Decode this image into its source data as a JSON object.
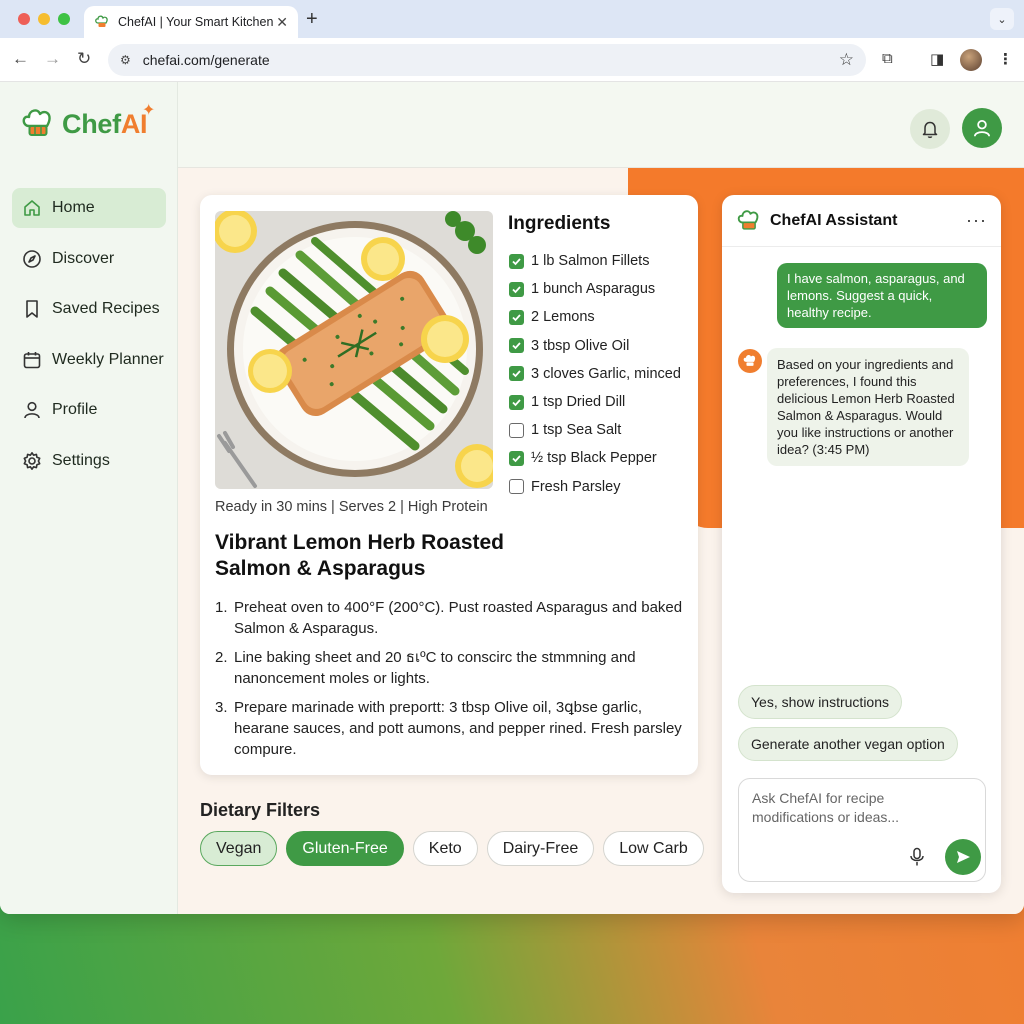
{
  "browser": {
    "tab_title": "ChefAI | Your Smart Kitchen",
    "url": "chefai.com/generate",
    "traffic_lights": [
      "#ee5f57",
      "#f6bd2f",
      "#3ec244"
    ]
  },
  "brand": {
    "name_prefix": "Chef",
    "name_suffix": "AI",
    "green": "#3f9a45",
    "orange": "#f07e2f"
  },
  "sidebar": {
    "items": [
      {
        "label": "Home",
        "icon": "home-icon",
        "active": true
      },
      {
        "label": "Discover",
        "icon": "compass-icon",
        "active": false
      },
      {
        "label": "Saved Recipes",
        "icon": "bookmark-icon",
        "active": false
      },
      {
        "label": "Weekly Planner",
        "icon": "calendar-icon",
        "active": false
      },
      {
        "label": "Profile",
        "icon": "person-icon",
        "active": false
      },
      {
        "label": "Settings",
        "icon": "gear-icon",
        "active": false
      }
    ]
  },
  "header": {
    "notifications_icon": "bell-icon",
    "user_icon": "user-icon"
  },
  "recipe": {
    "meta": "Ready in 30 mins | Serves 2 | High Protein",
    "title": "Vibrant Lemon Herb Roasted Salmon & Asparagus",
    "ingredients_title": "Ingredients",
    "ingredients": [
      {
        "label": "1 lb Salmon Fillets",
        "checked": true
      },
      {
        "label": "1 bunch Asparagus",
        "checked": true
      },
      {
        "label": "2 Lemons",
        "checked": true
      },
      {
        "label": "3 tbsp Olive Oil",
        "checked": true
      },
      {
        "label": "3 cloves Garlic, minced",
        "checked": true
      },
      {
        "label": "1 tsp Dried Dill",
        "checked": true
      },
      {
        "label": "1 tsp Sea Salt",
        "checked": false
      },
      {
        "label": "½ tsp Black Pepper",
        "checked": true
      },
      {
        "label": "Fresh Parsley",
        "checked": false
      }
    ],
    "steps": [
      {
        "num": "1.",
        "text": "Preheat oven to 400°F (200°C). Pust roasted Asparagus and baked Salmon & Asparagus."
      },
      {
        "num": "2.",
        "text": "Line baking sheet and 20 ธเºC to conscirc the stmmning and nanoncement moles or lights."
      },
      {
        "num": "3.",
        "text": "Prepare marinade with preportt: 3 tbsp Olive oil, 3ꝗbse garlic, hearane sauces, and pott aumons, and pepper rined. Fresh parsley compure."
      }
    ]
  },
  "filters": {
    "title": "Dietary Filters",
    "chips": [
      {
        "label": "Vegan",
        "style": "soft"
      },
      {
        "label": "Gluten-Free",
        "style": "solid"
      },
      {
        "label": "Keto",
        "style": "plain"
      },
      {
        "label": "Dairy-Free",
        "style": "plain"
      },
      {
        "label": "Low Carb",
        "style": "plain"
      }
    ]
  },
  "assistant": {
    "title": "ChefAI Assistant",
    "more": "···",
    "user_message": "I have salmon, asparagus, and lemons. Suggest a quick, healthy recipe.",
    "bot_message": "Based on your ingredients and preferences, I found this delicious Lemon Herb Roasted Salmon & Asparagus. Would you like instructions or another idea? (3:45 PM)",
    "suggestions": [
      "Yes, show instructions",
      "Generate another vegan option"
    ],
    "input_placeholder": "Ask ChefAI for recipe modifications or ideas..."
  }
}
